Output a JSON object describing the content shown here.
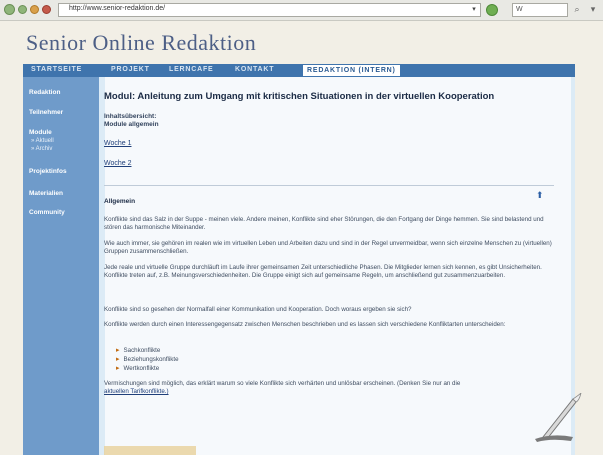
{
  "browser": {
    "url": "http://www.senior-redaktion.de/",
    "search_placeholder": "W",
    "url_dropdown_icon": "chevron-down-icon"
  },
  "site": {
    "title": "Senior Online Redaktion"
  },
  "nav": {
    "items": [
      "STARTSEITE",
      "PROJEKT",
      "LERNCAFE",
      "KONTAKT",
      "REDAKTION (INTERN)"
    ]
  },
  "sidebar": {
    "items": [
      "Redaktion",
      "Teilnehmer",
      "Module",
      "Projektinfos",
      "Materialien",
      "Community"
    ],
    "module_sub": [
      "» Aktuell",
      "» Archiv"
    ]
  },
  "content": {
    "title": "Modul: Anleitung zum Umgang mit kritischen Situationen in der virtuellen Kooperation",
    "overview": "Inhaltsübersicht:",
    "overview_sub": "Module allgemein",
    "week1": "Woche 1",
    "week2": "Woche 2",
    "section": "Allgemein",
    "p1": "Konflikte sind das Salz in der Suppe - meinen viele. Andere meinen, Konflikte sind eher Störungen, die den Fortgang der Dinge hemmen. Sie sind belastend und stören das harmonische Miteinander.",
    "p2": "Wie auch immer, sie gehören im realen wie im virtuellen Leben und Arbeiten dazu und sind in der Regel unvermeidbar, wenn sich einzelne Menschen zu (virtuellen) Gruppen zusammenschließen.",
    "p3": "Jede reale und virtuelle Gruppe durchläuft im Laufe ihrer gemeinsamen Zeit unterschiedliche Phasen. Die Mitglieder lernen sich kennen, es gibt Unsicherheiten. Konflikte treten auf, z.B. Meinungsverschiedenheiten. Die Gruppe einigt sich auf gemeinsame Regeln, um anschließend gut zusammenzuarbeiten.",
    "p4": "Konflikte sind so gesehen der Normalfall einer Kommunikation und Kooperation. Doch woraus ergeben sie sich?",
    "p5": "Konflikte werden durch einen Interessengegensatz zwischen Menschen beschrieben und es lassen sich verschiedene Konfliktarten unterscheiden:",
    "bullets": [
      "Sachkonflikte",
      "Beziehungskonflikte",
      "Wertkonflikte"
    ],
    "p6a": "Vermischungen sind möglich, das erklärt warum so viele Konflikte sich verhärten und unlösbar erscheinen. (Denken Sie nur an die",
    "p6b": "aktuellen Tarifkonflikte.)"
  }
}
